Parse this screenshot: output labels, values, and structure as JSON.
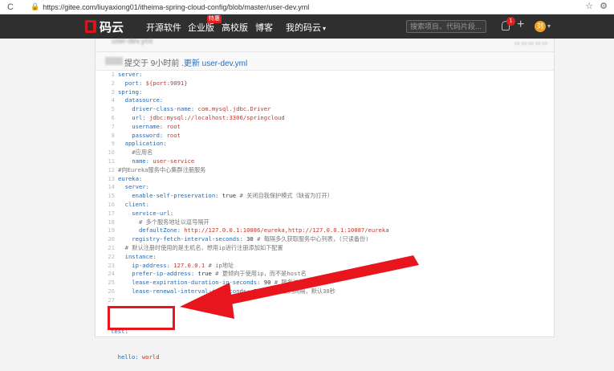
{
  "browser": {
    "reload_icon": "reload-icon",
    "url": "https://gitee.com/liuyaxiong01/itheima-spring-cloud-config/blob/master/user-dev.yml",
    "star_icon": "star-icon",
    "extension_icon": "extension-icon"
  },
  "nav": {
    "logo_text": "码云",
    "items": [
      "开源软件",
      "企业版",
      "高校版",
      "博客",
      "我的码云"
    ],
    "hot_badge": "特惠",
    "search_placeholder": "搜索项目、代码片段...",
    "notification_count": "1",
    "plus": "+",
    "avatar_text": "刘"
  },
  "file": {
    "name": "user-dev.yml"
  },
  "commit": {
    "text": "提交于 9小时前 .",
    "link": "更新 user-dev.yml"
  },
  "code_lines": [
    {
      "n": "1",
      "parts": [
        {
          "t": "server:",
          "s": "k"
        }
      ]
    },
    {
      "n": "2",
      "parts": [
        {
          "t": "  port: ",
          "s": "k"
        },
        {
          "t": "${port:9091}",
          "s": "v"
        }
      ]
    },
    {
      "n": "3",
      "parts": [
        {
          "t": "spring:",
          "s": "k"
        }
      ]
    },
    {
      "n": "4",
      "parts": [
        {
          "t": "  datasource:",
          "s": "k"
        }
      ]
    },
    {
      "n": "5",
      "parts": [
        {
          "t": "    driver-class-name: ",
          "s": "k"
        },
        {
          "t": "com.mysql.jdbc.Driver",
          "s": "v"
        }
      ]
    },
    {
      "n": "6",
      "parts": [
        {
          "t": "    url: ",
          "s": "k"
        },
        {
          "t": "jdbc:mysql://localhost:3306/springcloud",
          "s": "v"
        }
      ]
    },
    {
      "n": "7",
      "parts": [
        {
          "t": "    username: ",
          "s": "k"
        },
        {
          "t": "root",
          "s": "v"
        }
      ]
    },
    {
      "n": "8",
      "parts": [
        {
          "t": "    password: ",
          "s": "k"
        },
        {
          "t": "root",
          "s": "v"
        }
      ]
    },
    {
      "n": "9",
      "parts": [
        {
          "t": "  application:",
          "s": "k"
        }
      ]
    },
    {
      "n": "10",
      "parts": [
        {
          "t": "    #应用名",
          "s": "c"
        }
      ]
    },
    {
      "n": "11",
      "parts": [
        {
          "t": "    name: ",
          "s": "k"
        },
        {
          "t": "user-service",
          "s": "v"
        }
      ]
    },
    {
      "n": "12",
      "parts": [
        {
          "t": "#向Eureka服务中心集群注册服务",
          "s": "c"
        }
      ]
    },
    {
      "n": "13",
      "parts": [
        {
          "t": "eureka:",
          "s": "k"
        }
      ]
    },
    {
      "n": "14",
      "parts": [
        {
          "t": "  server:",
          "s": "k"
        }
      ]
    },
    {
      "n": "15",
      "parts": [
        {
          "t": "    enable-self-preservation: ",
          "s": "k"
        },
        {
          "t": "true ",
          "s": "p"
        },
        {
          "t": "# 关闭自我保护模式（缺省为打开）",
          "s": "c"
        }
      ]
    },
    {
      "n": "16",
      "parts": [
        {
          "t": "  client:",
          "s": "k"
        }
      ]
    },
    {
      "n": "17",
      "parts": [
        {
          "t": "    service-url:",
          "s": "k"
        }
      ]
    },
    {
      "n": "18",
      "parts": [
        {
          "t": "      # 多个服务地址以逗号隔开",
          "s": "c"
        }
      ]
    },
    {
      "n": "19",
      "parts": [
        {
          "t": "      defaultZone: ",
          "s": "k"
        },
        {
          "t": "http://127.0.0.1:10086/eureka,http://127.0.0.1:10087/eureka",
          "s": "v"
        }
      ]
    },
    {
      "n": "20",
      "parts": [
        {
          "t": "    registry-fetch-interval-seconds: ",
          "s": "k"
        },
        {
          "t": "30 ",
          "s": "p"
        },
        {
          "t": "# 每隔多久获取服务中心列表，(只读备份)",
          "s": "c"
        }
      ]
    },
    {
      "n": "21",
      "parts": [
        {
          "t": "  # 默认注册时使用的是主机名，想用ip进行注册添加如下配置",
          "s": "c"
        }
      ]
    },
    {
      "n": "22",
      "parts": [
        {
          "t": "  instance:",
          "s": "k"
        }
      ]
    },
    {
      "n": "23",
      "parts": [
        {
          "t": "    ip-address: ",
          "s": "k"
        },
        {
          "t": "127.0.0.1 ",
          "s": "v"
        },
        {
          "t": "# ip地址",
          "s": "c"
        }
      ]
    },
    {
      "n": "24",
      "parts": [
        {
          "t": "    prefer-ip-address: ",
          "s": "k"
        },
        {
          "t": "true ",
          "s": "p"
        },
        {
          "t": "# 更倾向于使用ip，而不是host名",
          "s": "c"
        }
      ]
    },
    {
      "n": "25",
      "parts": [
        {
          "t": "    lease-expiration-duration-in-seconds: ",
          "s": "k"
        },
        {
          "t": "90 ",
          "s": "p"
        },
        {
          "t": "# 服务过期时间",
          "s": "c"
        }
      ]
    },
    {
      "n": "26",
      "parts": [
        {
          "t": "    lease-renewal-interval-in-seconds: ",
          "s": "k"
        },
        {
          "t": "30 ",
          "s": "p"
        },
        {
          "t": "# 服务续约间隔，默认30秒",
          "s": "c"
        }
      ]
    },
    {
      "n": "27",
      "parts": []
    }
  ],
  "highlight": {
    "line1": "test:",
    "line2_key": "  hello: ",
    "line2_val": "world"
  },
  "colors": {
    "annotation": "#e8161c",
    "nav_bg": "#2f2f2f",
    "yaml_key": "#1e68b8",
    "yaml_value": "#c0392b"
  }
}
